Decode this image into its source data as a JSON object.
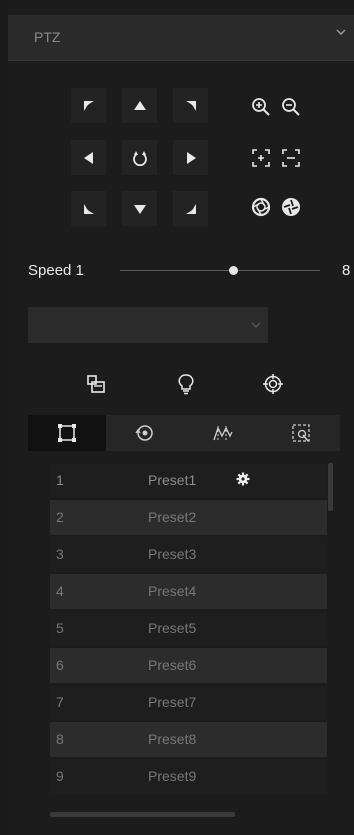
{
  "header": {
    "title": "PTZ",
    "chevron_icon": "chevron-down-icon"
  },
  "ptz_pad": {
    "directions": [
      "up-left",
      "up",
      "up-right",
      "left",
      "auto-rotate",
      "right",
      "down-left",
      "down",
      "down-right"
    ],
    "zoom_icons": [
      "zoom-in-icon",
      "zoom-out-icon"
    ],
    "focus_icons": [
      "focus-near-icon",
      "focus-far-icon"
    ],
    "iris_icons": [
      "iris-open-icon",
      "iris-close-icon"
    ]
  },
  "speed": {
    "label": "Speed 1",
    "max": "8",
    "value": 5,
    "min_value": 1,
    "max_value": 8
  },
  "select": {
    "value": ""
  },
  "tools": [
    "preset-copy-icon",
    "light-bulb-icon",
    "crosshair-icon"
  ],
  "tabs": [
    {
      "name": "preset-tab",
      "active": true
    },
    {
      "name": "patrol-tab",
      "active": false
    },
    {
      "name": "pattern-tab",
      "active": false
    },
    {
      "name": "track-tab",
      "active": false
    }
  ],
  "presets": [
    {
      "num": "1",
      "name": "Preset1"
    },
    {
      "num": "2",
      "name": "Preset2"
    },
    {
      "num": "3",
      "name": "Preset3"
    },
    {
      "num": "4",
      "name": "Preset4"
    },
    {
      "num": "5",
      "name": "Preset5"
    },
    {
      "num": "6",
      "name": "Preset6"
    },
    {
      "num": "7",
      "name": "Preset7"
    },
    {
      "num": "8",
      "name": "Preset8"
    },
    {
      "num": "9",
      "name": "Preset9"
    }
  ],
  "colors": {
    "background": "#1a1a1a",
    "button": "#232323",
    "text": "#e8e8e8",
    "muted": "#777777"
  }
}
